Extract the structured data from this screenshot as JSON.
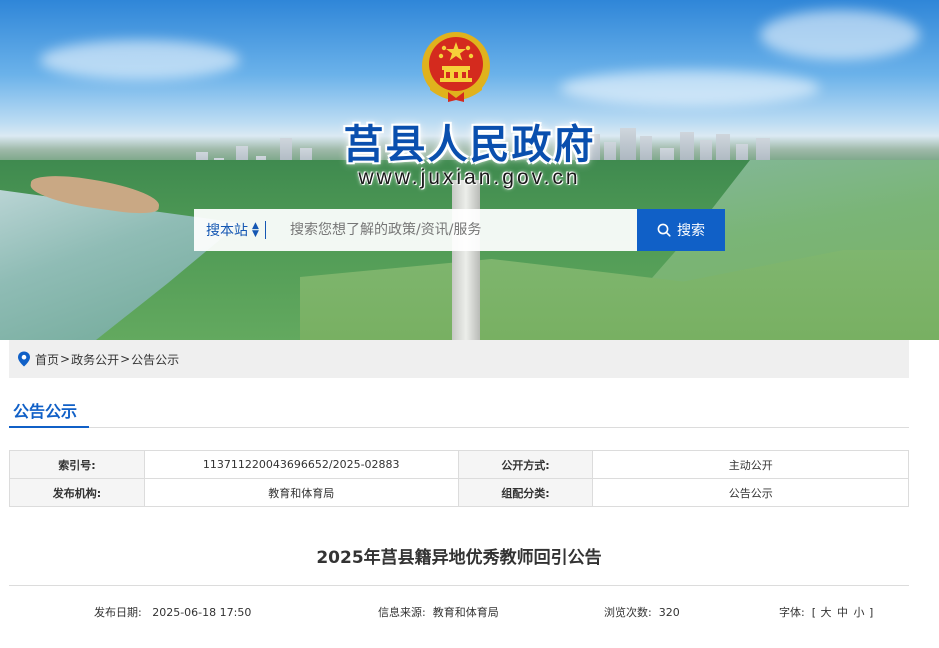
{
  "header": {
    "site_title": "莒县人民政府",
    "site_url": "www.juxian.gov.cn"
  },
  "search": {
    "scope_label": "搜本站",
    "placeholder": "搜索您想了解的政策/资讯/服务",
    "button_label": "搜索"
  },
  "breadcrumb": {
    "items": [
      "首页",
      "政务公开",
      "公告公示"
    ],
    "separator": ">"
  },
  "section": {
    "title": "公告公示"
  },
  "meta": {
    "rows": [
      {
        "k1": "索引号:",
        "v1": "113711220043696652/2025-02883",
        "k2": "公开方式:",
        "v2": "主动公开"
      },
      {
        "k1": "发布机构:",
        "v1": "教育和体育局",
        "k2": "组配分类:",
        "v2": "公告公示"
      }
    ]
  },
  "article": {
    "title": "2025年莒县籍异地优秀教师回引公告",
    "publish_label": "发布日期:",
    "publish_date": "2025-06-18 17:50",
    "source_label": "信息来源:",
    "source_value": "教育和体育局",
    "views_label": "浏览次数:",
    "views_value": "320",
    "font_label": "字体:",
    "font_open": "[",
    "font_large": "大",
    "font_medium": "中",
    "font_small": "小",
    "font_close": "]"
  },
  "colors": {
    "brand_blue": "#1060c7",
    "title_blue": "#0a4fae"
  }
}
